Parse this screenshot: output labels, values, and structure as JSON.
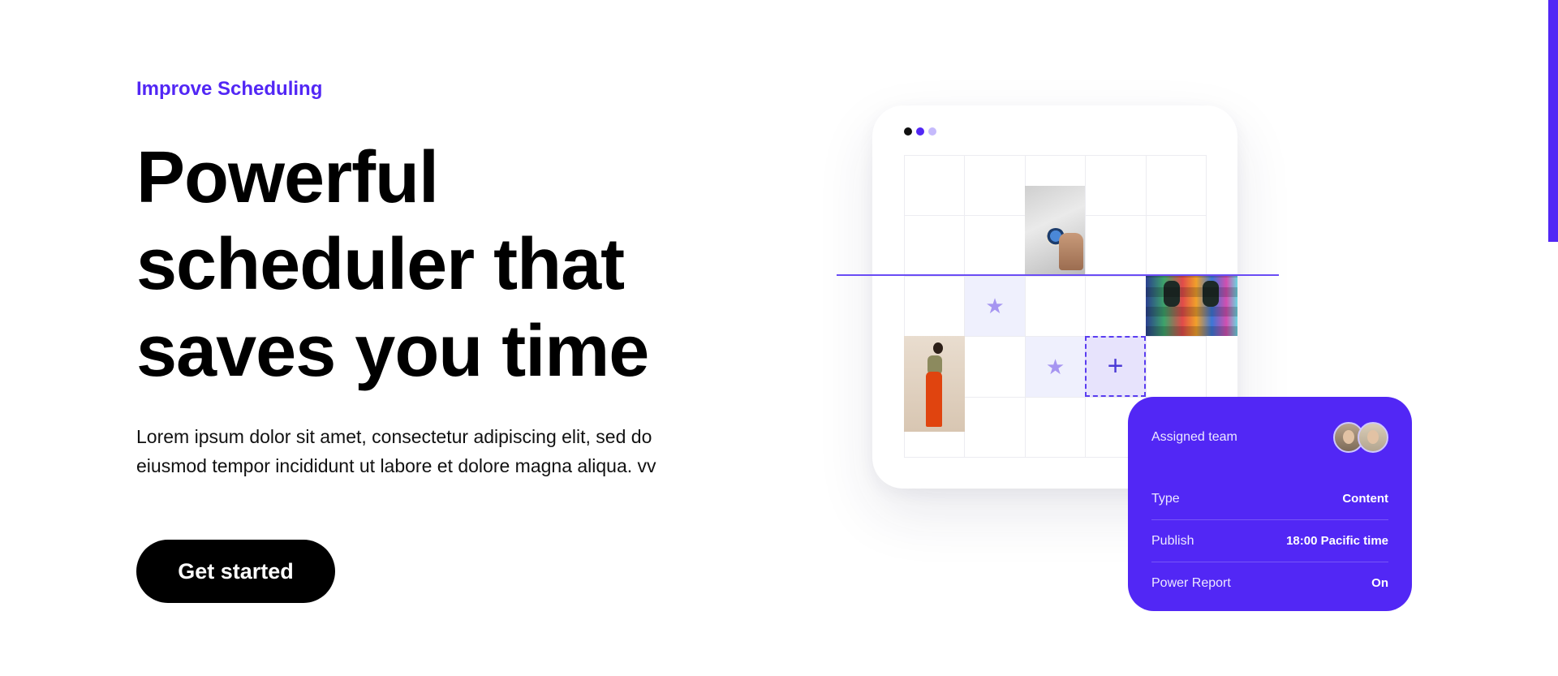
{
  "hero": {
    "eyebrow": "Improve Scheduling",
    "headline_lines": [
      "Powerful",
      "scheduler that",
      "saves you time"
    ],
    "description_lines": [
      "Lorem ipsum dolor sit amet, consectetur adipiscing elit, sed do",
      "eiusmod tempor incididunt ut labore et dolore magna aliqua. vv"
    ],
    "cta_label": "Get started"
  },
  "colors": {
    "accent": "#5227f5",
    "text": "#0b0b0b",
    "cell_tint": "#eff0fd",
    "star": "#a695f1",
    "window_dots": [
      "#111111",
      "#5227f5",
      "#c5bafc"
    ]
  },
  "scheduler": {
    "window_dot_icons": [
      "dot-icon",
      "dot-icon",
      "dot-icon"
    ],
    "grid_rows": 5,
    "grid_cols": 5,
    "tinted_cells": [
      [
        2,
        1
      ],
      [
        3,
        2
      ]
    ],
    "star_cells": [
      [
        2,
        1
      ],
      [
        3,
        2
      ]
    ],
    "photo_icons": [
      "coffee-photo",
      "dance-floor-photo",
      "woman-portrait-photo"
    ],
    "drop_target_icon": "plus-icon",
    "drop_target_symbol": "+"
  },
  "details": {
    "assigned_team_label": "Assigned team",
    "team_avatars": [
      "avatar-man",
      "avatar-woman"
    ],
    "rows": [
      {
        "label": "Type",
        "value": "Content"
      },
      {
        "label": "Publish",
        "value": "18:00 Pacific time"
      },
      {
        "label": "Power Report",
        "value": "On"
      }
    ]
  }
}
